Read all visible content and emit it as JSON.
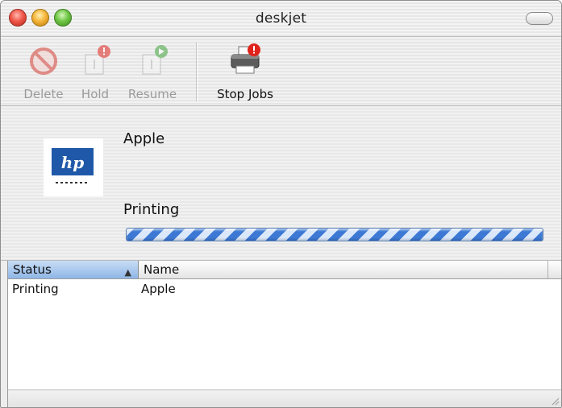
{
  "window": {
    "title": "deskjet"
  },
  "toolbar": {
    "delete_label": "Delete",
    "hold_label": "Hold",
    "resume_label": "Resume",
    "stop_jobs_label": "Stop Jobs"
  },
  "job": {
    "document_name": "Apple",
    "status": "Printing",
    "progress": "indeterminate"
  },
  "table": {
    "columns": [
      "Status",
      "Name"
    ],
    "sorted_column": "Status",
    "rows": [
      {
        "status": "Printing",
        "name": "Apple"
      }
    ]
  },
  "icons": {
    "delete": "delete-icon",
    "hold": "hold-icon",
    "resume": "resume-icon",
    "stop_jobs": "printer-alert-icon",
    "logo": "hp-logo-icon"
  },
  "colors": {
    "progress_blue": "#3d79d4",
    "alert_red": "#e0231b",
    "resume_green": "#3ea33a",
    "header_selected": "#a9c8ee"
  }
}
